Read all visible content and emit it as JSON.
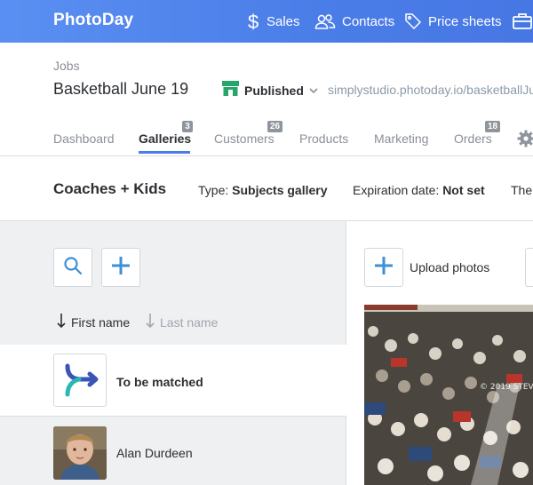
{
  "app": {
    "logo": "PhotoDay"
  },
  "nav": [
    {
      "label": "Sales",
      "icon": "dollar-icon"
    },
    {
      "label": "Contacts",
      "icon": "contacts-icon"
    },
    {
      "label": "Price sheets",
      "icon": "tag-icon"
    }
  ],
  "job": {
    "breadcrumb": "Jobs",
    "title": "Basketball June 19",
    "status": "Published",
    "url": "simplystudio.photoday.io/basketballJu"
  },
  "tabs": [
    {
      "label": "Dashboard",
      "badge": ""
    },
    {
      "label": "Galleries",
      "badge": "3",
      "active": true
    },
    {
      "label": "Customers",
      "badge": "26"
    },
    {
      "label": "Products",
      "badge": ""
    },
    {
      "label": "Marketing",
      "badge": ""
    },
    {
      "label": "Orders",
      "badge": "18"
    }
  ],
  "gallery": {
    "name": "Coaches + Kids",
    "type_label": "Type:",
    "type_value": "Subjects gallery",
    "expiration_label": "Expiration date:",
    "expiration_value": "Not set",
    "extra": "The"
  },
  "left_panel": {
    "sort_first": "First name",
    "sort_last": "Last name",
    "rows": [
      {
        "label": "To be matched",
        "bold": true
      },
      {
        "label": "Alan Durdeen",
        "bold": false
      }
    ]
  },
  "right_panel": {
    "upload_label": "Upload photos",
    "watermark": "© 2019 STEVE"
  },
  "colors": {
    "brand_blue": "#4b7de8",
    "published_green": "#27a56a",
    "icon_blue": "#3d8fd6"
  }
}
